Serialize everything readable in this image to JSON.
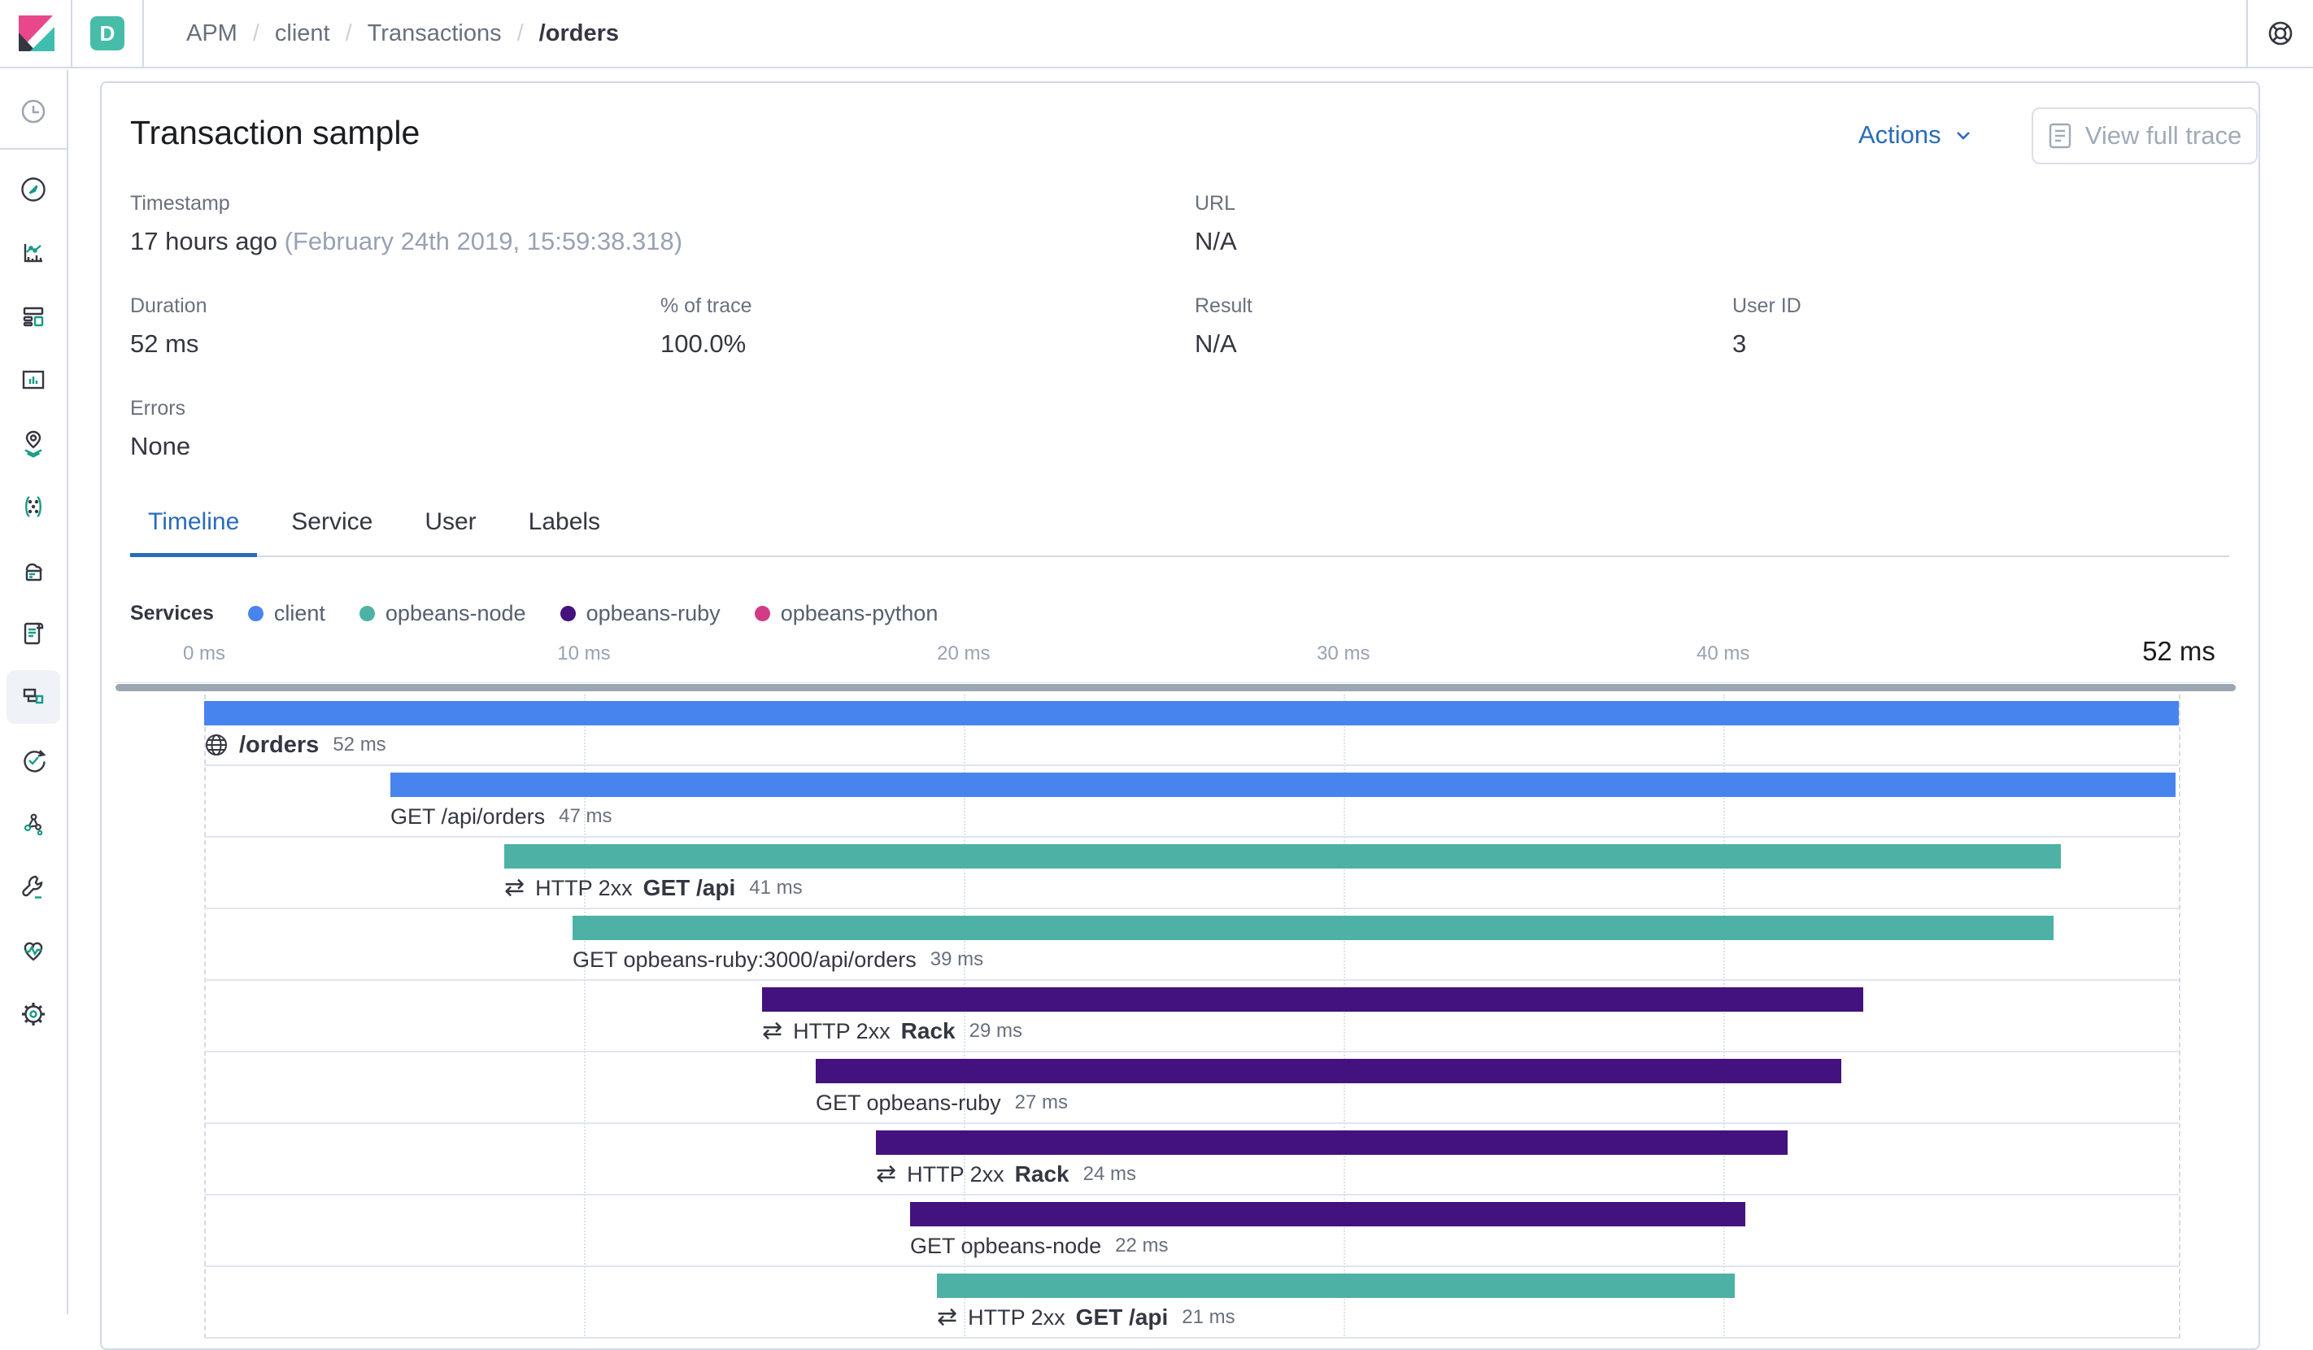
{
  "topbar": {
    "space_badge": "D",
    "breadcrumbs": [
      "APM",
      "client",
      "Transactions",
      "/orders"
    ],
    "separator": "/",
    "icons": [
      "kibana-logo",
      "help-icon"
    ]
  },
  "sidebar": {
    "selected": "apm",
    "items": [
      "recently-viewed",
      "discover",
      "visualize",
      "dashboard",
      "canvas",
      "maps",
      "machine-learning",
      "infrastructure",
      "logs",
      "apm",
      "uptime",
      "graph",
      "dev-tools",
      "monitoring",
      "management"
    ]
  },
  "header": {
    "title": "Transaction sample",
    "actions_label": "Actions",
    "view_full_trace_label": "View full trace"
  },
  "metadata": {
    "timestamp": {
      "label": "Timestamp",
      "relative": "17 hours ago",
      "absolute": "(February 24th 2019, 15:59:38.318)"
    },
    "url": {
      "label": "URL",
      "value": "N/A"
    },
    "duration": {
      "label": "Duration",
      "value": "52 ms"
    },
    "percent_of_trace": {
      "label": "% of trace",
      "value": "100.0%"
    },
    "result": {
      "label": "Result",
      "value": "N/A"
    },
    "user_id": {
      "label": "User ID",
      "value": "3"
    },
    "errors": {
      "label": "Errors",
      "value": "None"
    }
  },
  "tabs": [
    {
      "label": "Timeline",
      "active": true
    },
    {
      "label": "Service",
      "active": false
    },
    {
      "label": "User",
      "active": false
    },
    {
      "label": "Labels",
      "active": false
    }
  ],
  "legend": {
    "title": "Services",
    "services": [
      {
        "name": "client",
        "color": "#4784EE"
      },
      {
        "name": "opbeans-node",
        "color": "#4DB2A5"
      },
      {
        "name": "opbeans-ruby",
        "color": "#43127E"
      },
      {
        "name": "opbeans-python",
        "color": "#D23C87"
      }
    ]
  },
  "colors": {
    "accent_blue": "#2A6CBA",
    "border": "#D3DAE6",
    "badge_teal": "#47BCA9",
    "scrollbar": "#9CA6B3"
  },
  "chart_data": {
    "type": "waterfall-timeline",
    "title": "Transaction trace waterfall",
    "unit": "ms",
    "axis_ticks": [
      {
        "value": 0,
        "label": "0 ms"
      },
      {
        "value": 10,
        "label": "10 ms"
      },
      {
        "value": 20,
        "label": "20 ms"
      },
      {
        "value": 30,
        "label": "30 ms"
      },
      {
        "value": 40,
        "label": "40 ms"
      }
    ],
    "total_ms": 52,
    "total_label": "52 ms",
    "rows": [
      {
        "kind": "transaction",
        "icon": "globe",
        "name": "/orders",
        "duration_label": "52 ms",
        "start_ms": 0,
        "duration_ms": 52,
        "service": "client"
      },
      {
        "kind": "span",
        "name": "GET /api/orders",
        "duration_label": "47 ms",
        "start_ms": 4.9,
        "duration_ms": 47,
        "service": "client"
      },
      {
        "kind": "transaction",
        "icon": "merge",
        "prefix": "HTTP 2xx",
        "name": "GET /api",
        "duration_label": "41 ms",
        "start_ms": 7.9,
        "duration_ms": 41,
        "service": "opbeans-node"
      },
      {
        "kind": "span",
        "name": "GET opbeans-ruby:3000/api/orders",
        "duration_label": "39 ms",
        "start_ms": 9.7,
        "duration_ms": 39,
        "service": "opbeans-node"
      },
      {
        "kind": "transaction",
        "icon": "merge",
        "prefix": "HTTP 2xx",
        "name": "Rack",
        "duration_label": "29 ms",
        "start_ms": 14.7,
        "duration_ms": 29,
        "service": "opbeans-ruby"
      },
      {
        "kind": "span",
        "name": "GET opbeans-ruby",
        "duration_label": "27 ms",
        "start_ms": 16.1,
        "duration_ms": 27,
        "service": "opbeans-ruby"
      },
      {
        "kind": "transaction",
        "icon": "merge",
        "prefix": "HTTP 2xx",
        "name": "Rack",
        "duration_label": "24 ms",
        "start_ms": 17.7,
        "duration_ms": 24,
        "service": "opbeans-ruby"
      },
      {
        "kind": "span",
        "name": "GET opbeans-node",
        "duration_label": "22 ms",
        "start_ms": 18.6,
        "duration_ms": 22,
        "service": "opbeans-ruby"
      },
      {
        "kind": "transaction",
        "icon": "merge",
        "prefix": "HTTP 2xx",
        "name": "GET /api",
        "duration_label": "21 ms",
        "start_ms": 19.3,
        "duration_ms": 21,
        "service": "opbeans-node"
      }
    ]
  }
}
